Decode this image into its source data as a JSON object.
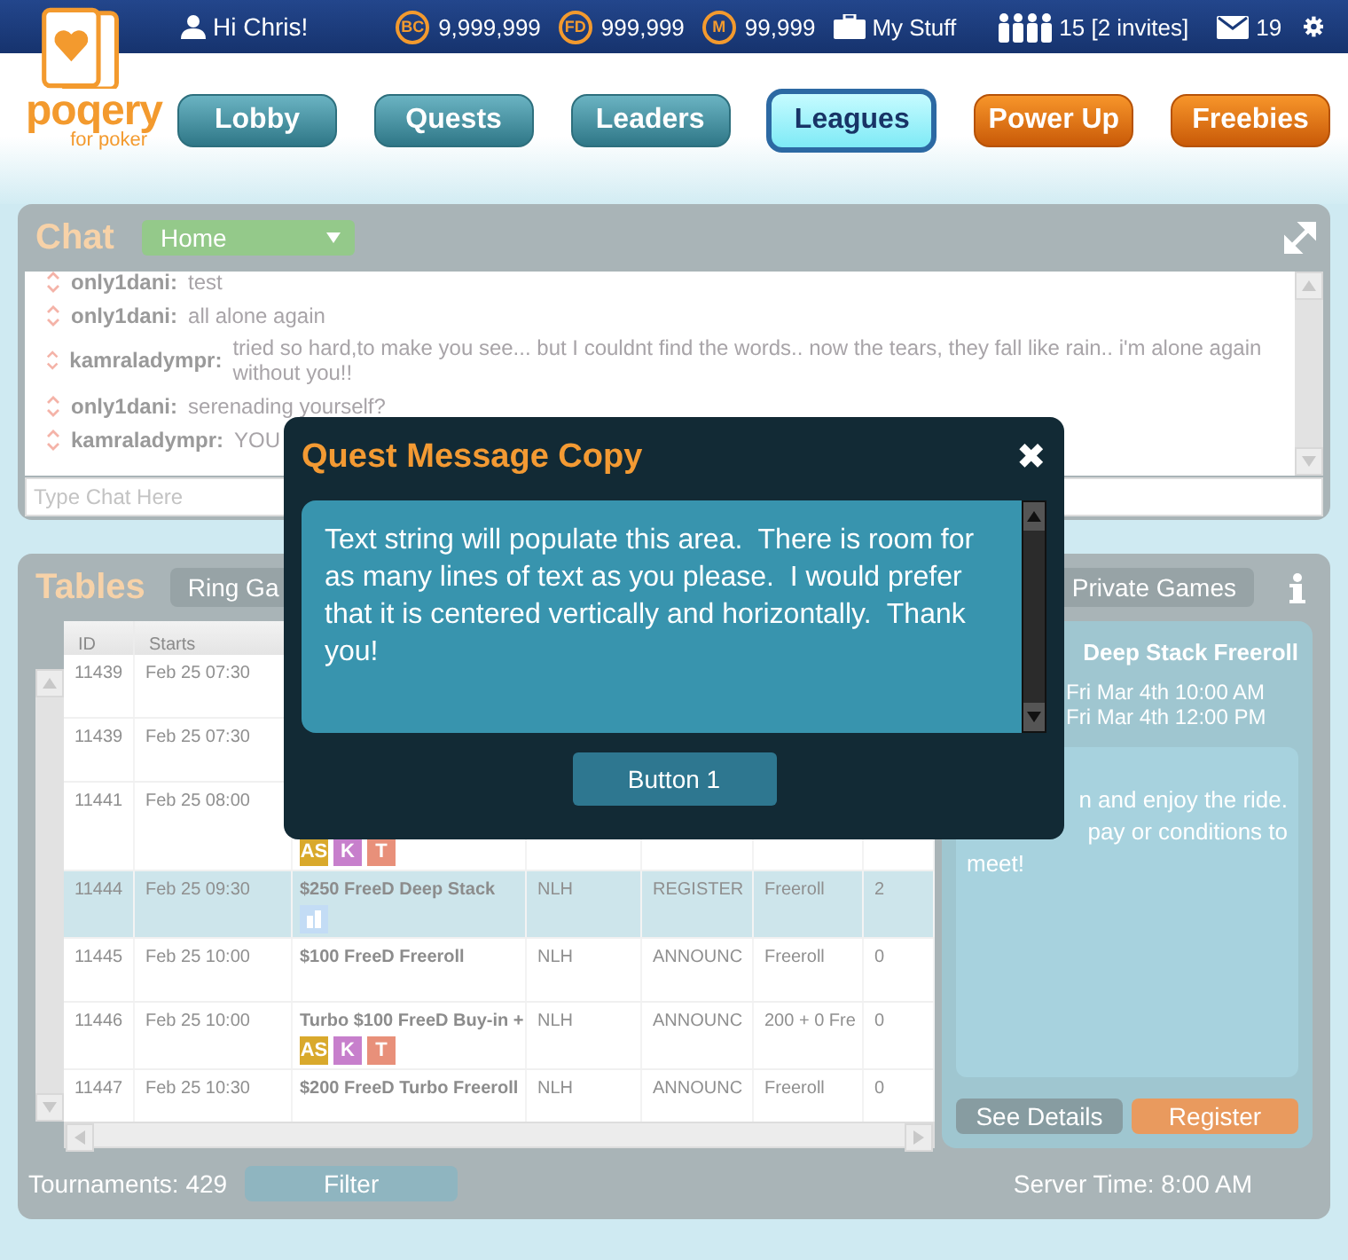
{
  "header": {
    "greeting": "Hi Chris!",
    "currencies": [
      {
        "symbol": "BC",
        "amount": "9,999,999"
      },
      {
        "symbol": "FD",
        "amount": "999,999"
      },
      {
        "symbol": "M",
        "amount": "99,999"
      }
    ],
    "my_stuff": "My Stuff",
    "friends": "15 [2 invites]",
    "messages": "19"
  },
  "logo": {
    "name": "poqery",
    "tagline": "for poker"
  },
  "nav": [
    {
      "label": "Lobby",
      "kind": "standard",
      "selected": false
    },
    {
      "label": "Quests",
      "kind": "standard",
      "selected": false
    },
    {
      "label": "Leaders",
      "kind": "standard",
      "selected": false
    },
    {
      "label": "Leagues",
      "kind": "standard",
      "selected": true
    },
    {
      "label": "Power Up",
      "kind": "promo",
      "selected": false
    },
    {
      "label": "Freebies",
      "kind": "promo",
      "selected": false
    }
  ],
  "chat": {
    "title": "Chat",
    "room": "Home",
    "placeholder": "Type Chat Here",
    "messages": [
      {
        "user": "only1dani:",
        "text": "test"
      },
      {
        "user": "only1dani:",
        "text": "all alone again"
      },
      {
        "user": "kamraladympr:",
        "text": "tried so hard,to make you see... but I couldnt find the words.. now the tears, they fall like rain.. i'm alone again without you!!"
      },
      {
        "user": "only1dani:",
        "text": "serenading yourself?"
      },
      {
        "user": "kamraladympr:",
        "text": "YOU"
      }
    ]
  },
  "tables": {
    "title": "Tables",
    "tabs": [
      {
        "label": "Ring Ga",
        "selected": false
      },
      {
        "label": "Private Games",
        "selected": false
      }
    ],
    "columns": [
      "ID",
      "Starts"
    ],
    "rows": [
      {
        "id": "11439",
        "starts": "Feb 25 07:30",
        "selected": false
      },
      {
        "id": "11439",
        "starts": "Feb 25 07:30",
        "selected": false
      },
      {
        "id": "11441",
        "starts": "Feb 25 08:00",
        "selected": false,
        "badges": [
          {
            "kind": "text",
            "label": "AS",
            "color": "#d9a92c"
          },
          {
            "kind": "text",
            "label": "K",
            "color": "#c77fcc"
          },
          {
            "kind": "text",
            "label": "T",
            "color": "#e8907a"
          }
        ]
      },
      {
        "id": "11444",
        "starts": "Feb 25 09:30",
        "name": "$250 FreeD Deep Stack",
        "game": "NLH",
        "status": "REGISTER",
        "buyin": "Freeroll",
        "players": "2",
        "selected": true,
        "badges": [
          {
            "kind": "chart",
            "color": "#c3dcf5"
          }
        ]
      },
      {
        "id": "11445",
        "starts": "Feb 25 10:00",
        "name": "$100 FreeD Freeroll",
        "game": "NLH",
        "status": "ANNOUNC",
        "buyin": "Freeroll",
        "players": "0",
        "selected": false
      },
      {
        "id": "11446",
        "starts": "Feb 25 10:00",
        "name": "Turbo $100 FreeD Buy-in +",
        "game": "NLH",
        "status": "ANNOUNC",
        "buyin": "200 + 0 Fre",
        "players": "0",
        "selected": false,
        "badges": [
          {
            "kind": "text",
            "label": "AS",
            "color": "#d9a92c"
          },
          {
            "kind": "text",
            "label": "K",
            "color": "#c77fcc"
          },
          {
            "kind": "text",
            "label": "T",
            "color": "#e8907a"
          }
        ]
      },
      {
        "id": "11447",
        "starts": "Feb 25 10:30",
        "name": "$200 FreeD Turbo Freeroll",
        "game": "NLH",
        "status": "ANNOUNC",
        "buyin": "Freeroll",
        "players": "0",
        "selected": false
      }
    ],
    "count": "Tournaments: 429",
    "filter": "Filter",
    "server_time": "Server Time: 8:00 AM",
    "details": {
      "title": "Deep Stack Freeroll",
      "times": [
        "Fri Mar 4th 10:00 AM",
        "Fri Mar 4th 12:00 PM"
      ],
      "description": [
        {
          "text": "n and enjoy the ride.",
          "clipped": true
        },
        {
          "text": "pay or conditions to",
          "clipped": true
        },
        {
          "text": "meet!",
          "clipped": false
        }
      ],
      "see_details": "See Details",
      "register": "Register"
    }
  },
  "modal": {
    "title": "Quest Message Copy",
    "close": "✖",
    "message": "Text string will populate this area.  There is room for as many lines of text as you please.  I would prefer that it is centered vertically and horizontally.  Thank  you!",
    "button": "Button 1"
  }
}
